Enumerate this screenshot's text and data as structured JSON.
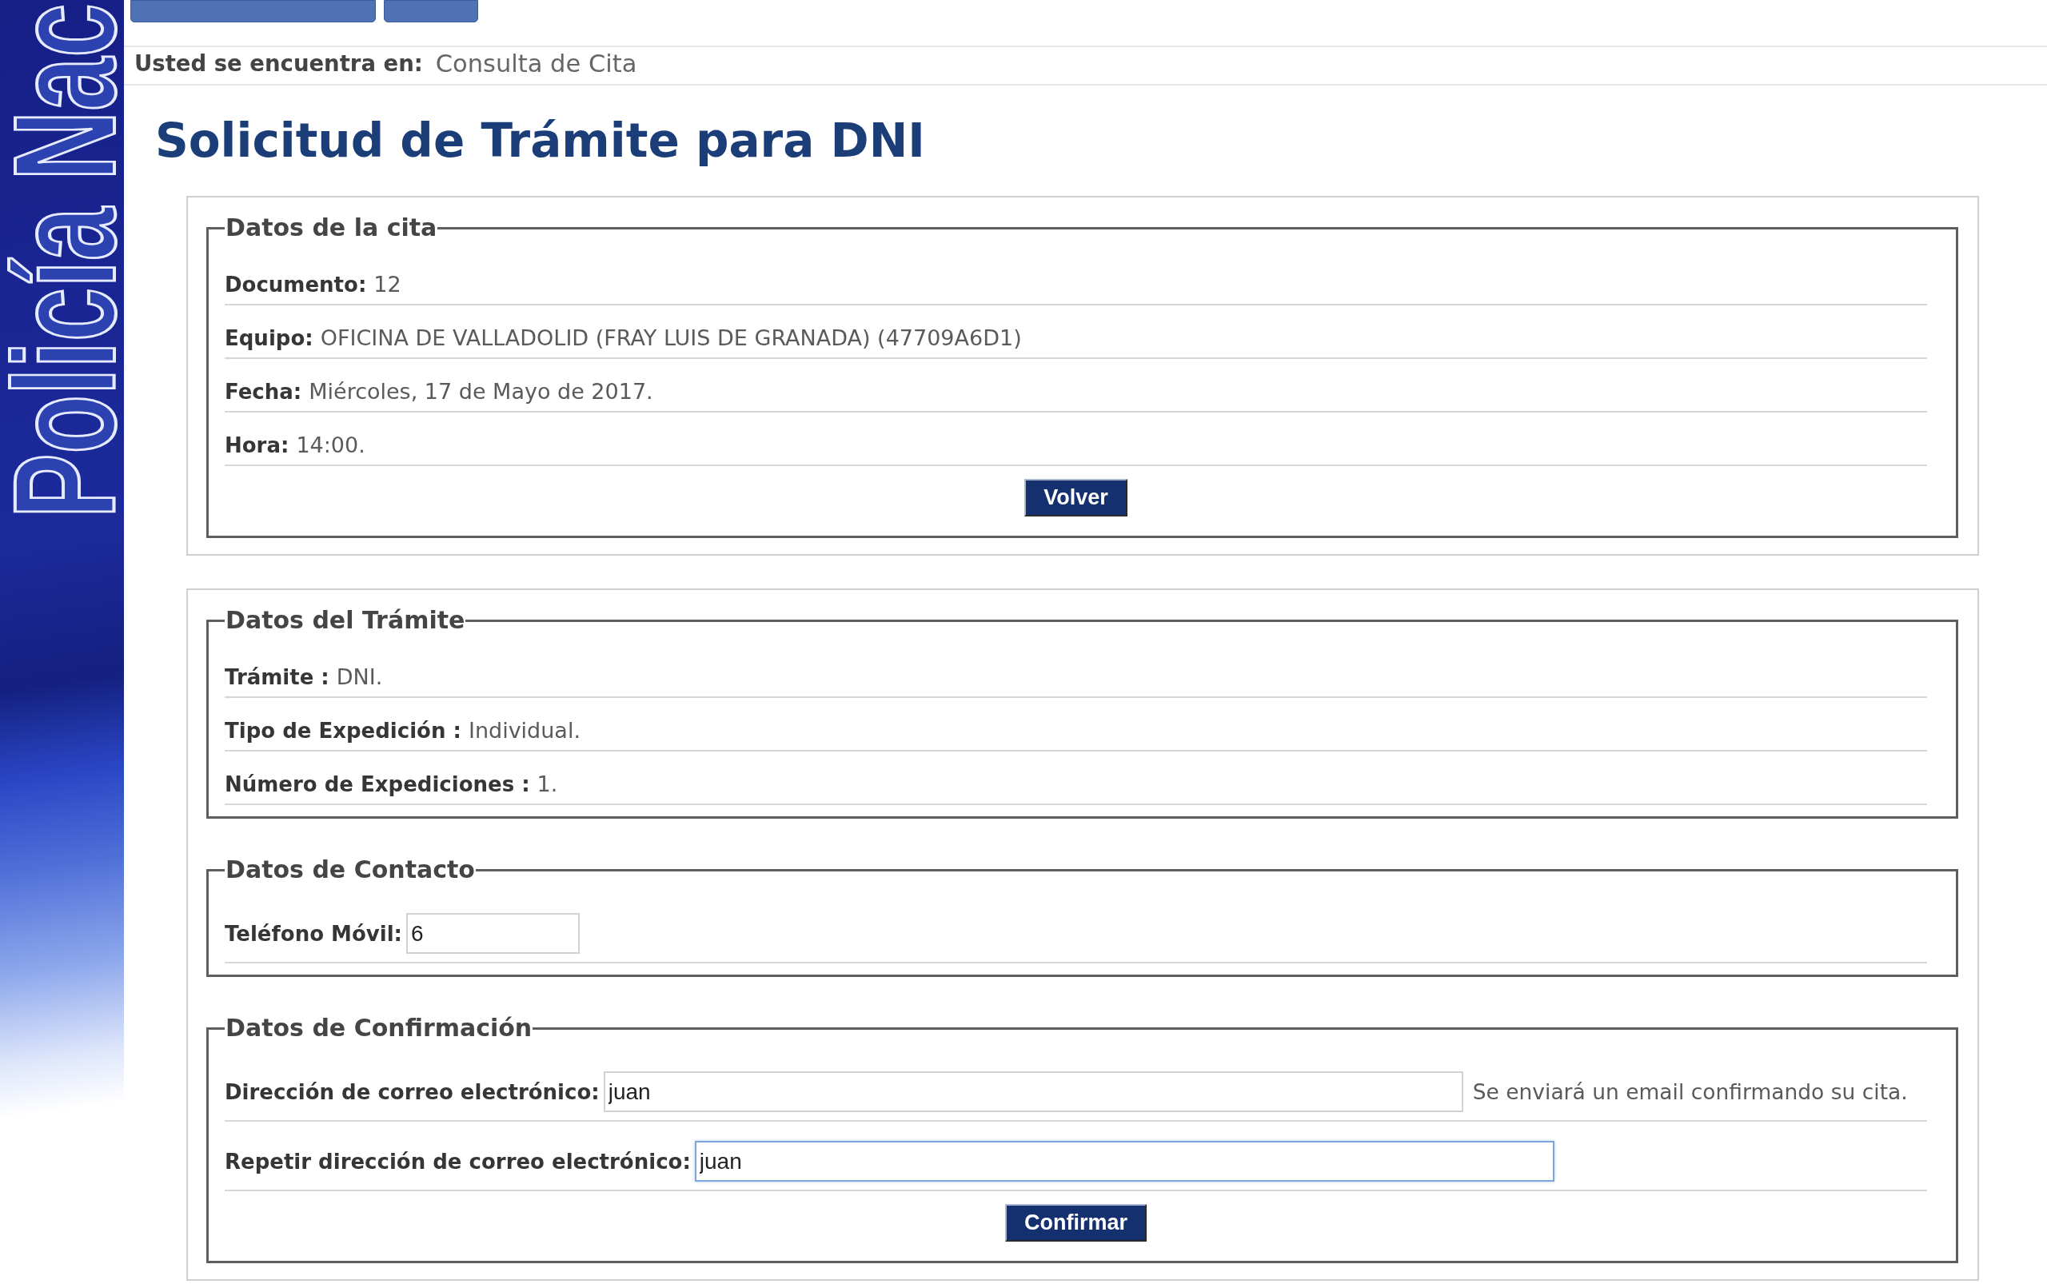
{
  "sidebar": {
    "banner_text": "Policía Nac"
  },
  "breadcrumb": {
    "label": "Usted se encuentra en:",
    "current": "Consulta de Cita"
  },
  "title": "Solicitud de Trámite para DNI",
  "panels": [
    {
      "fieldsets": [
        {
          "legend": "Datos de la cita",
          "rows": [
            {
              "kind": "text",
              "label": "Documento:",
              "value": "12"
            },
            {
              "kind": "text",
              "label": "Equipo:",
              "value": "OFICINA DE VALLADOLID (FRAY LUIS DE GRANADA) (47709A6D1)"
            },
            {
              "kind": "text",
              "label": "Fecha:",
              "value": "Miércoles, 17 de Mayo de 2017."
            },
            {
              "kind": "text",
              "label": "Hora:",
              "value": "14:00."
            }
          ],
          "button": "Volver"
        }
      ]
    },
    {
      "fieldsets": [
        {
          "legend": "Datos del Trámite",
          "rows": [
            {
              "kind": "text",
              "label": "Trámite :",
              "value": "DNI."
            },
            {
              "kind": "text",
              "label": "Tipo de Expedición :",
              "value": "Individual."
            },
            {
              "kind": "text",
              "label": "Número de Expediciones :",
              "value": "1."
            }
          ]
        },
        {
          "legend": "Datos de Contacto",
          "rows": [
            {
              "kind": "phone",
              "label": "Teléfono Móvil:",
              "value": "6",
              "focused": false
            }
          ]
        },
        {
          "legend": "Datos de Confirmación",
          "rows": [
            {
              "kind": "email",
              "label": "Dirección de correo electrónico:",
              "value": "juan",
              "focused": false,
              "hint": "Se enviará un email confirmando su cita."
            },
            {
              "kind": "email",
              "label": "Repetir dirección de correo electrónico:",
              "value": "juan",
              "focused": true
            }
          ],
          "button": "Confirmar"
        }
      ]
    }
  ]
}
